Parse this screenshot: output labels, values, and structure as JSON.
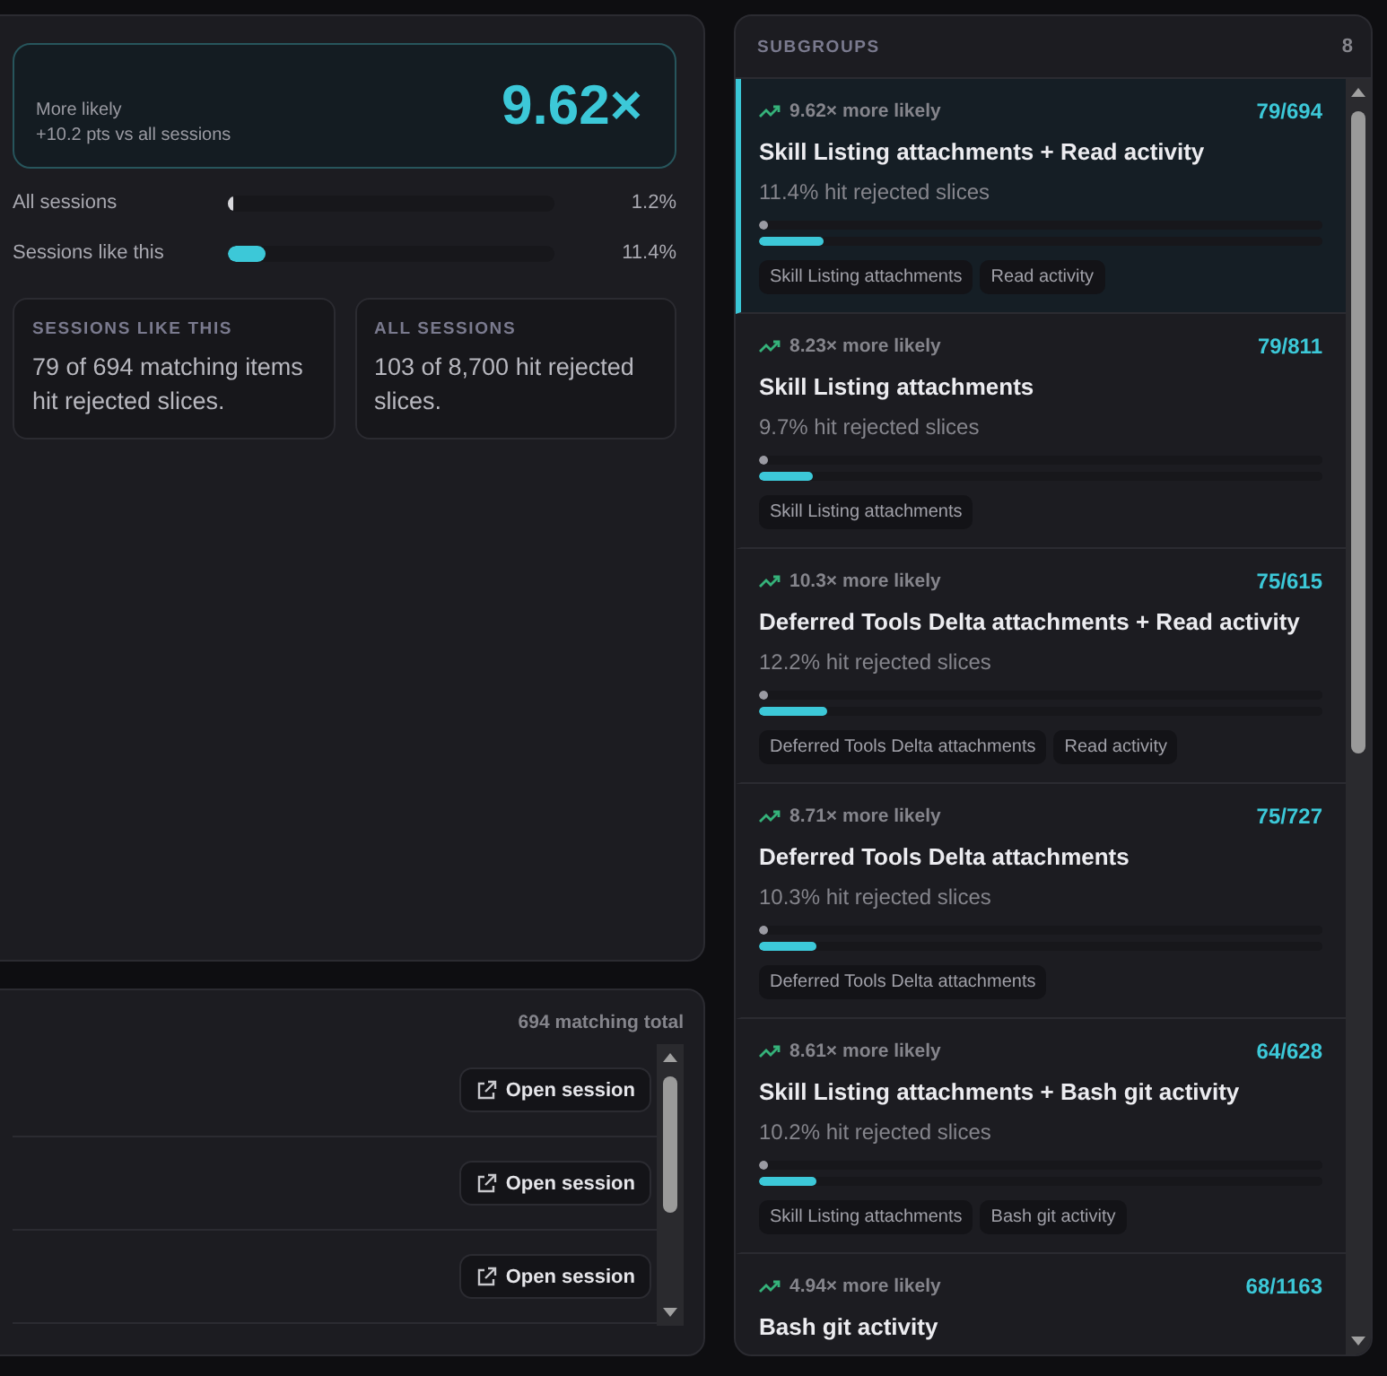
{
  "summary": {
    "ratio": "9.62×",
    "label": "More likely",
    "delta": "+10.2 pts vs all sessions"
  },
  "comparison": [
    {
      "label": "All sessions",
      "level": 0.012,
      "reading": "1.2%"
    },
    {
      "label": "Sessions like this",
      "level": 0.114,
      "reading": "11.4%"
    }
  ],
  "stat_cards": [
    {
      "title": "SESSIONS LIKE THIS",
      "text": "79 of 694 matching items hit rejected slices."
    },
    {
      "title": "ALL SESSIONS",
      "text": "103 of 8,700 hit rejected slices."
    }
  ],
  "sessions": {
    "total": "694 matching total",
    "rows": [
      {
        "action": "Open session"
      },
      {
        "action": "Open session"
      },
      {
        "action": "Open session"
      }
    ]
  },
  "subgroups": {
    "title": "SUBGROUPS",
    "count": "8",
    "items": [
      {
        "lift": "9.62× more likely",
        "ratio": "79/694",
        "title": "Skill Listing attachments + Read activity",
        "rate": "11.4% hit rejected slices",
        "baseline": {
          "level": 0.012
        },
        "level": 0.114,
        "tags": [
          "Skill Listing attachments",
          "Read activity"
        ],
        "selected": true
      },
      {
        "lift": "8.23× more likely",
        "ratio": "79/811",
        "title": "Skill Listing attachments",
        "rate": "9.7% hit rejected slices",
        "baseline": {
          "level": 0.012
        },
        "level": 0.097,
        "tags": [
          "Skill Listing attachments"
        ],
        "selected": false
      },
      {
        "lift": "10.3× more likely",
        "ratio": "75/615",
        "title": "Deferred Tools Delta attachments + Read activity",
        "rate": "12.2% hit rejected slices",
        "baseline": {
          "level": 0.012
        },
        "level": 0.122,
        "tags": [
          "Deferred Tools Delta attachments",
          "Read activity"
        ],
        "selected": false
      },
      {
        "lift": "8.71× more likely",
        "ratio": "75/727",
        "title": "Deferred Tools Delta attachments",
        "rate": "10.3% hit rejected slices",
        "baseline": {
          "level": 0.012
        },
        "level": 0.103,
        "tags": [
          "Deferred Tools Delta attachments"
        ],
        "selected": false
      },
      {
        "lift": "8.61× more likely",
        "ratio": "64/628",
        "title": "Skill Listing attachments + Bash git activity",
        "rate": "10.2% hit rejected slices",
        "baseline": {
          "level": 0.012
        },
        "level": 0.102,
        "tags": [
          "Skill Listing attachments",
          "Bash git activity"
        ],
        "selected": false
      },
      {
        "lift": "4.94× more likely",
        "ratio": "68/1163",
        "title": "Bash git activity",
        "selected": false
      }
    ]
  }
}
